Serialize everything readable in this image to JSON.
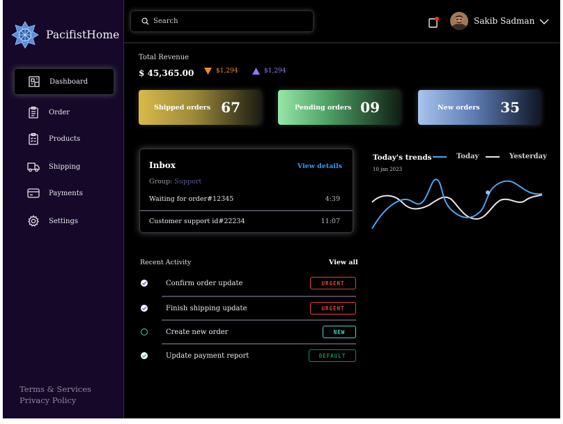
{
  "brand": {
    "name": "PacifistHome"
  },
  "sidebar": {
    "items": [
      {
        "label": "Dashboard",
        "icon": "dashboard-icon",
        "active": true
      },
      {
        "label": "Order",
        "icon": "clipboard-icon"
      },
      {
        "label": "Products",
        "icon": "product-list-icon"
      },
      {
        "label": "Shipping",
        "icon": "truck-icon"
      },
      {
        "label": "Payments",
        "icon": "card-icon"
      },
      {
        "label": "Settings",
        "icon": "gear-icon"
      }
    ],
    "footer": {
      "terms": "Terms & Services",
      "privacy": "Privacy Policy"
    }
  },
  "header": {
    "search_placeholder": "Search",
    "user_name": "Sakib Sadman",
    "notification_dot_color": "#ff2a2a"
  },
  "revenue": {
    "label": "Total Revenue",
    "value": "$ 45,365.00",
    "down_change": "$1,294",
    "up_change": "$1,294",
    "down_color": "#f08a24",
    "up_color": "#8b7cf6"
  },
  "stats": [
    {
      "label": "Shipped orders",
      "value": "67"
    },
    {
      "label": "Pending orders",
      "value": "09"
    },
    {
      "label": "New orders",
      "value": "35"
    }
  ],
  "inbox": {
    "title": "Inbox",
    "link": "View details",
    "group_label": "Group:",
    "group_value": "Support",
    "rows": [
      {
        "text": "Waiting for order#12345",
        "time": "4:39"
      },
      {
        "text": "Customer support id#22234",
        "time": "11:07"
      }
    ]
  },
  "trends": {
    "title": "Today's trends",
    "date": "10 jan 2023",
    "legend_today": "Today",
    "legend_yesterday": "Yesterday",
    "today_color": "#4aa6f0",
    "yesterday_color": "#e8e8ee"
  },
  "recent_activity": {
    "title": "Recent Activity",
    "link": "View all",
    "items": [
      {
        "text": "Confirm order update",
        "badge": "URGENT",
        "badge_color": "#e0443a",
        "status": "checked",
        "check_color": "#6b7cf6"
      },
      {
        "text": "Finish shipping update",
        "badge": "URGENT",
        "badge_color": "#e0443a",
        "status": "checked",
        "check_color": "#6b7cf6"
      },
      {
        "text": "Create new order",
        "badge": "NEW",
        "badge_color": "#4fd0c6",
        "status": "unchecked",
        "check_color": "#4fd0c6"
      },
      {
        "text": "Update payment report",
        "badge": "DEFAULT",
        "badge_color": "#1f8a55",
        "status": "checked",
        "check_color": "#5fd39a"
      }
    ]
  }
}
